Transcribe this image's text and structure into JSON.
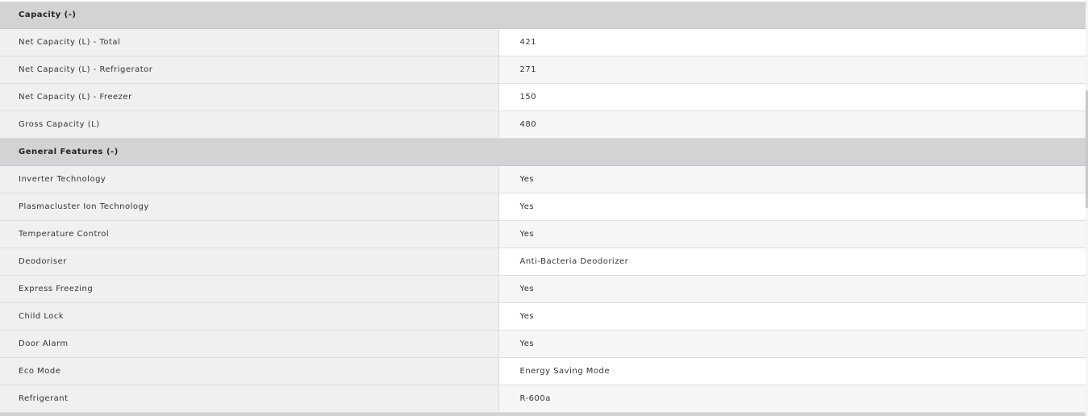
{
  "sections": [
    {
      "title": "Capacity (-)",
      "rows": [
        {
          "label": "Net Capacity (L) - Total",
          "value": "421"
        },
        {
          "label": "Net Capacity (L) - Refrigerator",
          "value": "271"
        },
        {
          "label": "Net Capacity (L) - Freezer",
          "value": "150"
        },
        {
          "label": "Gross Capacity (L)",
          "value": "480"
        }
      ]
    },
    {
      "title": "General Features (-)",
      "rows": [
        {
          "label": "Inverter Technology",
          "value": "Yes"
        },
        {
          "label": "Plasmacluster Ion Technology",
          "value": "Yes"
        },
        {
          "label": "Temperature Control",
          "value": "Yes"
        },
        {
          "label": "Deodoriser",
          "value": "Anti-Bacteria Deodorizer"
        },
        {
          "label": "Express Freezing",
          "value": "Yes"
        },
        {
          "label": "Child Lock",
          "value": "Yes"
        },
        {
          "label": "Door Alarm",
          "value": "Yes"
        },
        {
          "label": "Eco Mode",
          "value": "Energy Saving Mode"
        },
        {
          "label": "Refrigerant",
          "value": "R-600a"
        }
      ]
    }
  ]
}
